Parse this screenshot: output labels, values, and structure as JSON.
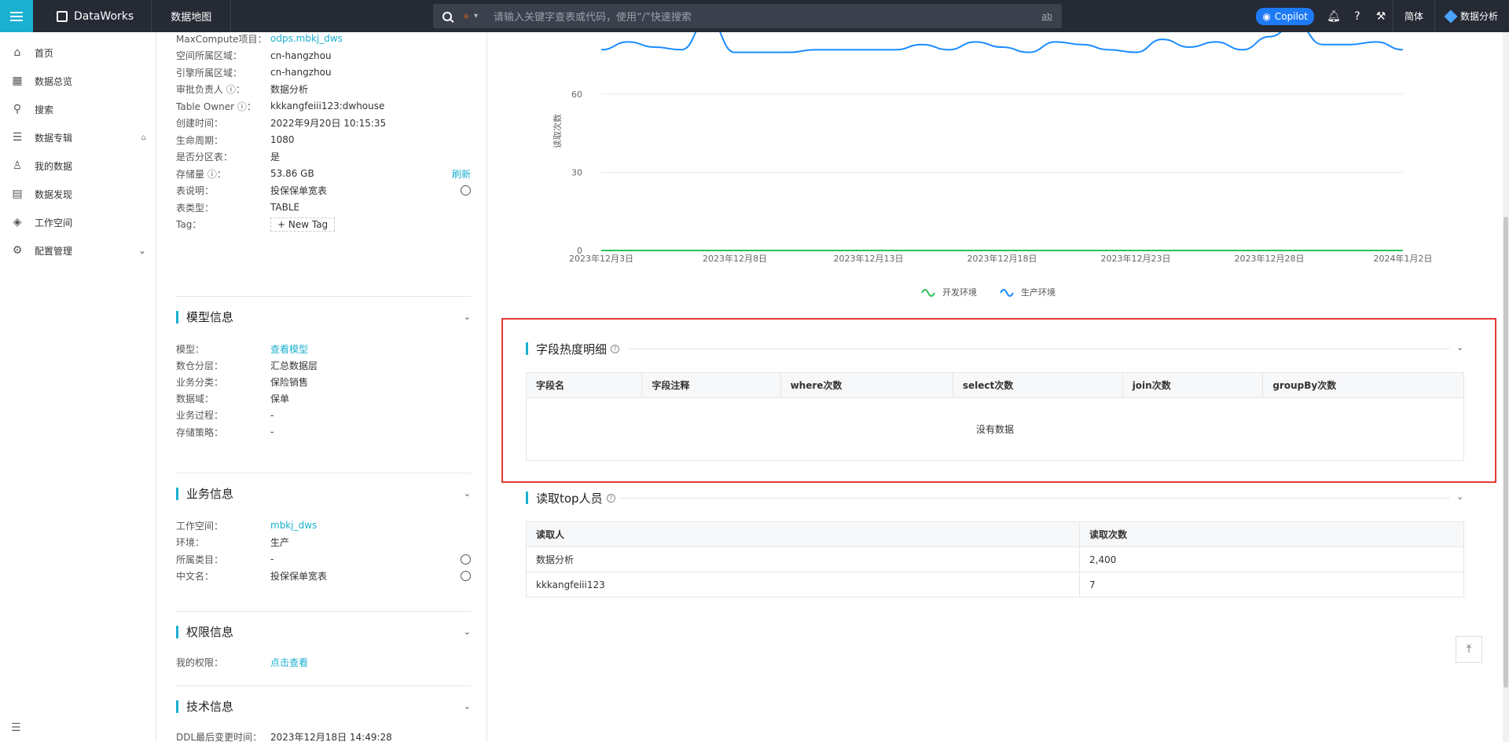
{
  "topbar": {
    "brand": "DataWorks",
    "module": "数据地图",
    "search_scope": "SQL",
    "search_placeholder": "请输入关键字查表或代码，使用“/”快速搜索",
    "search_ab": "ab",
    "copilot": "Copilot",
    "lang": "简体",
    "user": "数据分析"
  },
  "sidenav": {
    "items": [
      {
        "label": "首页"
      },
      {
        "label": "数据总览"
      },
      {
        "label": "搜索"
      },
      {
        "label": "数据专辑"
      },
      {
        "label": "我的数据"
      },
      {
        "label": "数据发现"
      },
      {
        "label": "工作空间"
      },
      {
        "label": "配置管理"
      }
    ]
  },
  "basic": {
    "rows": [
      {
        "k": "MaxCompute项目：",
        "v": "odps.mbkj_dws"
      },
      {
        "k": "空间所属区域：",
        "v": "cn-hangzhou"
      },
      {
        "k": "引擎所属区域：",
        "v": "cn-hangzhou"
      },
      {
        "k": "审批负责人 ⓘ：",
        "v": "数据分析"
      },
      {
        "k": "Table Owner ⓘ：",
        "v": "kkkangfeiii123:dwhouse"
      },
      {
        "k": "创建时间：",
        "v": "2022年9月20日 10:15:35"
      },
      {
        "k": "生命周期：",
        "v": "1080"
      },
      {
        "k": "是否分区表：",
        "v": "是"
      },
      {
        "k": "存储量 ⓘ：",
        "v": "53.86 GB",
        "action": "刷新"
      },
      {
        "k": "表说明：",
        "v": "投保保单宽表"
      },
      {
        "k": "表类型：",
        "v": "TABLE"
      },
      {
        "k": "Tag：",
        "v": "+  New Tag"
      }
    ]
  },
  "model": {
    "title": "模型信息",
    "rows": [
      {
        "k": "模型：",
        "v": "查看模型"
      },
      {
        "k": "数仓分层：",
        "v": "汇总数据层"
      },
      {
        "k": "业务分类：",
        "v": "保险销售"
      },
      {
        "k": "数据域：",
        "v": "保单"
      },
      {
        "k": "业务过程：",
        "v": "-"
      },
      {
        "k": "存储策略：",
        "v": "-"
      }
    ]
  },
  "business": {
    "title": "业务信息",
    "rows": [
      {
        "k": "工作空间：",
        "v": "mbkj_dws"
      },
      {
        "k": "环境：",
        "v": "生产"
      },
      {
        "k": "所属类目：",
        "v": "-"
      },
      {
        "k": "中文名：",
        "v": "投保保单宽表"
      }
    ]
  },
  "permission": {
    "title": "权限信息",
    "rows": [
      {
        "k": "我的权限：",
        "v": "点击查看"
      }
    ]
  },
  "tech": {
    "title": "技术信息",
    "rows": [
      {
        "k": "DDL最后变更时间：",
        "v": "2023年12月18日 14:49:28"
      }
    ]
  },
  "chart_data": {
    "type": "line",
    "ylabel": "读取次数",
    "yticks": [
      0,
      30,
      60
    ],
    "ylim": [
      0,
      90
    ],
    "x_tick_labels": [
      "2023年12月3日",
      "2023年12月8日",
      "2023年12月13日",
      "2023年12月18日",
      "2023年12月23日",
      "2023年12月28日",
      "2024年1月2日"
    ],
    "x": [
      "2023-12-03",
      "2023-12-04",
      "2023-12-05",
      "2023-12-06",
      "2023-12-07",
      "2023-12-08",
      "2023-12-09",
      "2023-12-10",
      "2023-12-11",
      "2023-12-12",
      "2023-12-13",
      "2023-12-14",
      "2023-12-15",
      "2023-12-16",
      "2023-12-17",
      "2023-12-18",
      "2023-12-19",
      "2023-12-20",
      "2023-12-21",
      "2023-12-22",
      "2023-12-23",
      "2023-12-24",
      "2023-12-25",
      "2023-12-26",
      "2023-12-27",
      "2023-12-28",
      "2023-12-29",
      "2023-12-30",
      "2023-12-31",
      "2024-01-01",
      "2024-01-02"
    ],
    "series": [
      {
        "name": "开发环境",
        "color": "#2ec15b",
        "values": [
          0,
          0,
          0,
          0,
          0,
          0,
          0,
          0,
          0,
          0,
          0,
          0,
          0,
          0,
          0,
          0,
          0,
          0,
          0,
          0,
          0,
          0,
          0,
          0,
          0,
          0,
          0,
          0,
          0,
          0,
          0
        ]
      },
      {
        "name": "生产环境",
        "color": "#1a8cff",
        "values": [
          77,
          80,
          78,
          77,
          89,
          76,
          76,
          76,
          77,
          77,
          77,
          77,
          79,
          77,
          80,
          78,
          76,
          80,
          79,
          77,
          76,
          81,
          78,
          80,
          77,
          82,
          87,
          79,
          79,
          80,
          77
        ]
      }
    ],
    "legend": "bottom-center"
  },
  "field_heat": {
    "title": "字段热度明细",
    "columns": [
      "字段名",
      "字段注释",
      "where次数",
      "select次数",
      "join次数",
      "groupBy次数"
    ],
    "empty": "没有数据"
  },
  "top_readers": {
    "title": "读取top人员",
    "columns": [
      "读取人",
      "读取次数"
    ],
    "rows": [
      [
        "数据分析",
        "2,400"
      ],
      [
        "kkkangfeiii123",
        "7"
      ]
    ]
  }
}
